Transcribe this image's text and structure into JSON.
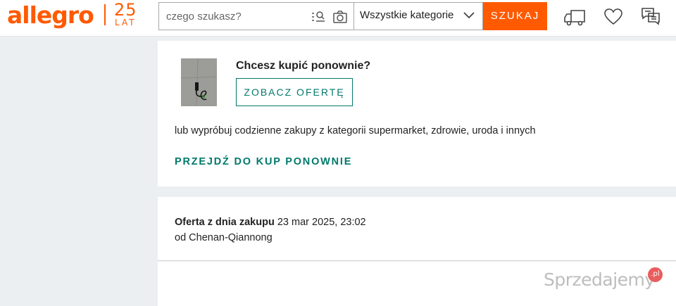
{
  "header": {
    "logo_text": "allegro",
    "anniversary_number": "25",
    "anniversary_label": "LAT",
    "search_placeholder": "czego szukasz?",
    "category_selected": "Wszystkie kategorie",
    "search_button": "SZUKAJ",
    "icons": [
      "camera-icon",
      "list-search-icon",
      "delivery-truck-icon",
      "heart-icon",
      "messages-icon"
    ]
  },
  "buy_again": {
    "title": "Chcesz kupić ponownie?",
    "offer_button": "ZOBACZ OFERTĘ",
    "suggestion": "lub wypróbuj codzienne zakupy z kategorii supermarket, zdrowie, uroda i innych",
    "goto_link": "PRZEJDŹ DO KUP PONOWNIE"
  },
  "order": {
    "offer_label": "Oferta z dnia zakupu",
    "purchase_date": "23 mar 2025, 23:02",
    "seller_line": "od Chenan-Qiannong"
  },
  "watermark": {
    "text": "Sprzedajemy",
    "badge": ".pl"
  },
  "colors": {
    "brand": "#ff5a00",
    "link": "#00796b",
    "background": "#eceff1"
  }
}
